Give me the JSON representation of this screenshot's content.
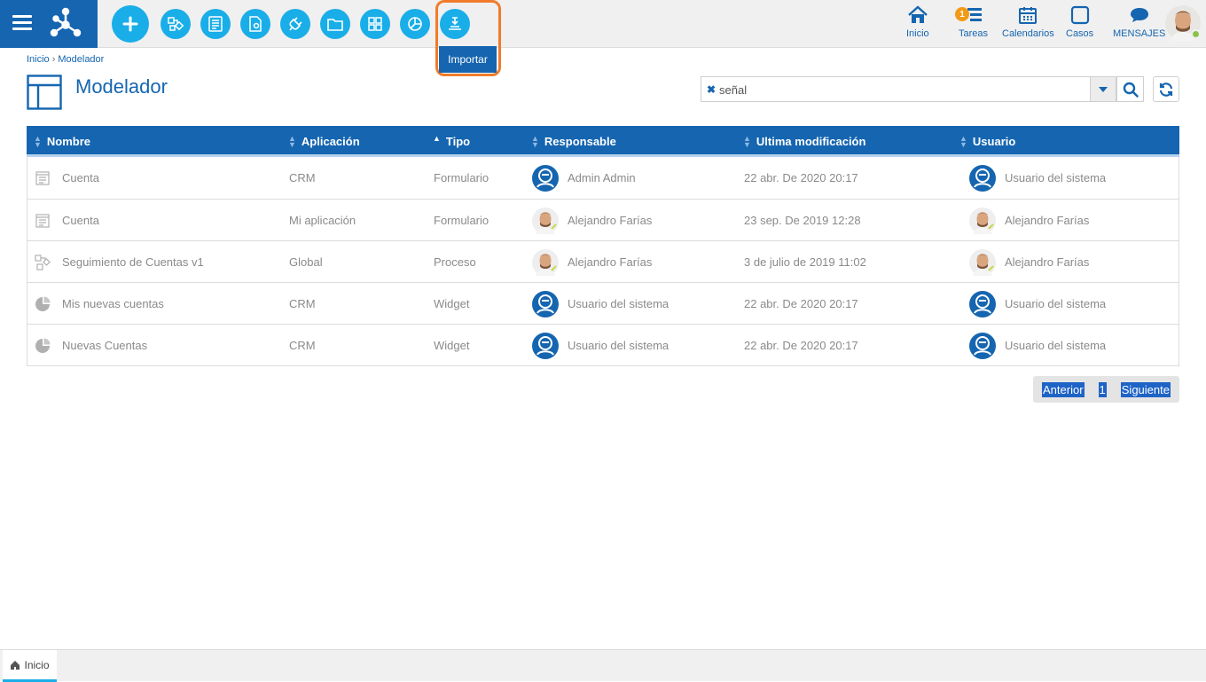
{
  "toolbar": {
    "tooltip": "Importar"
  },
  "nav": {
    "home": "Inicio",
    "tasks": "Tareas",
    "tasks_badge": "1",
    "calendars": "Calendarios",
    "cases": "Casos",
    "messages": "MENSAJES"
  },
  "breadcrumb": {
    "home": "Inicio",
    "separator": "›",
    "current": "Modelador"
  },
  "page": {
    "title": "Modelador"
  },
  "search": {
    "value": "señal",
    "clear": "✖"
  },
  "table": {
    "columns": [
      "Nombre",
      "Aplicación",
      "Tipo",
      "Responsable",
      "Ultima modificación",
      "Usuario"
    ],
    "rows": [
      {
        "icon": "form-icon",
        "name": "Cuenta",
        "app": "CRM",
        "type": "Formulario",
        "responsible": "Admin Admin",
        "responsible_avatar": "system",
        "modified": "22 abr. De 2020 20:17",
        "user": "Usuario del sistema",
        "user_avatar": "system"
      },
      {
        "icon": "form-icon",
        "name": "Cuenta",
        "app": "Mi aplicación",
        "type": "Formulario",
        "responsible": "Alejandro Farías",
        "responsible_avatar": "photo",
        "modified": "23 sep. De 2019 12:28",
        "user": "Alejandro Farías",
        "user_avatar": "photo"
      },
      {
        "icon": "process-icon",
        "name": "Seguimiento de Cuentas v1",
        "app": "Global",
        "type": "Proceso",
        "responsible": "Alejandro Farías",
        "responsible_avatar": "photo",
        "modified": "3 de julio de 2019 11:02",
        "user": "Alejandro Farías",
        "user_avatar": "photo"
      },
      {
        "icon": "widget-icon",
        "name": "Mis nuevas cuentas",
        "app": "CRM",
        "type": "Widget",
        "responsible": "Usuario del sistema",
        "responsible_avatar": "system",
        "modified": "22 abr. De 2020 20:17",
        "user": "Usuario del sistema",
        "user_avatar": "system"
      },
      {
        "icon": "widget-icon",
        "name": "Nuevas Cuentas",
        "app": "CRM",
        "type": "Widget",
        "responsible": "Usuario del sistema",
        "responsible_avatar": "system",
        "modified": "22 abr. De 2020 20:17",
        "user": "Usuario del sistema",
        "user_avatar": "system"
      }
    ]
  },
  "pagination": {
    "prev": "Anterior",
    "page": "1",
    "next": "Siguiente"
  },
  "footer": {
    "tab": "Inicio"
  },
  "colors": {
    "primary": "#1565b0",
    "accent": "#19aee8",
    "highlight": "#f07c2b",
    "badge": "#f29a16"
  }
}
